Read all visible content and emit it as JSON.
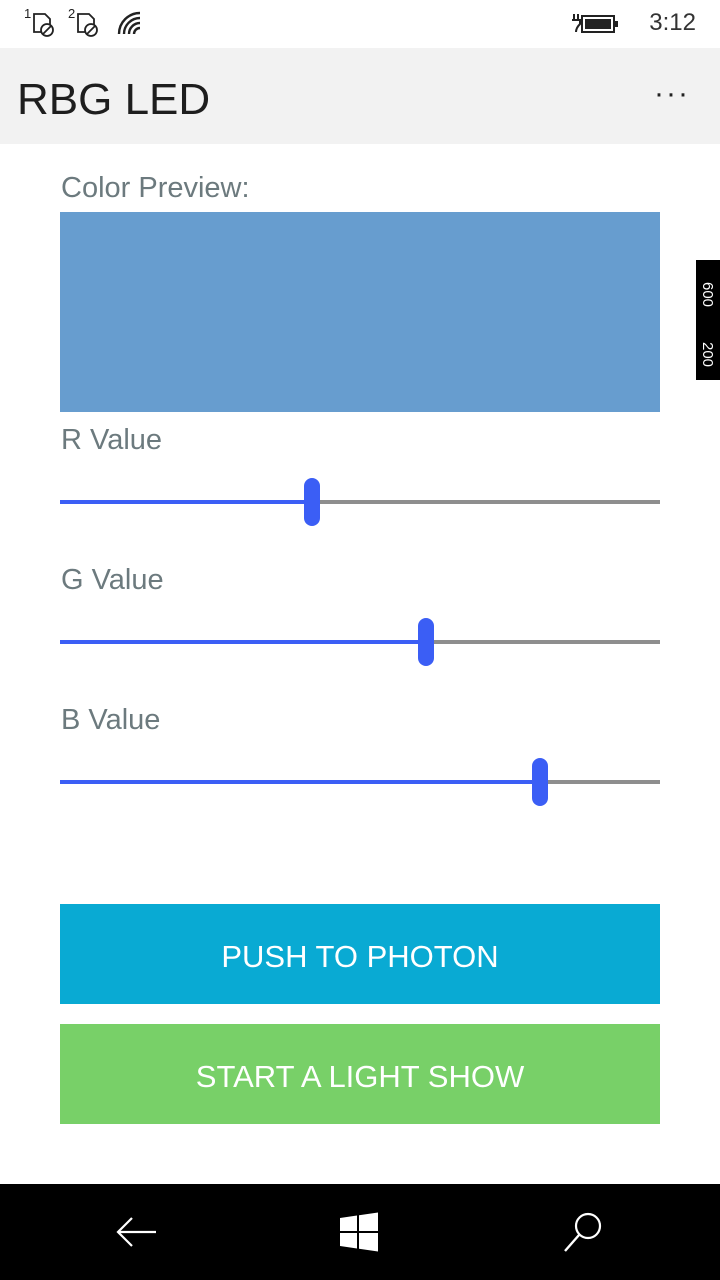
{
  "status_bar": {
    "sim1_label": "1",
    "sim2_label": "2",
    "time": "3:12",
    "icons": [
      "sim1-no-service-icon",
      "sim2-no-service-icon",
      "wifi-signal-icon",
      "battery-charging-icon"
    ]
  },
  "app_bar": {
    "title": "RBG LED",
    "more_label": "···"
  },
  "preview": {
    "label": "Color Preview:",
    "color": "#679dcf"
  },
  "sliders": [
    {
      "label": "R Value",
      "fraction": 0.42
    },
    {
      "label": "G Value",
      "fraction": 0.61
    },
    {
      "label": "B Value",
      "fraction": 0.8
    }
  ],
  "buttons": {
    "push_label": "PUSH TO PHOTON",
    "light_show_label": "START A LIGHT SHOW"
  },
  "side_tag": {
    "line1": "600",
    "line2": "200"
  },
  "colors": {
    "accent": "#3b5ef5",
    "track": "#8e8e8e",
    "push_button": "#09aad3",
    "light_show_button": "#78d068",
    "label": "#6c7a7e"
  },
  "nav_bar": {
    "icons": [
      "back-arrow-icon",
      "windows-start-icon",
      "search-icon"
    ]
  }
}
